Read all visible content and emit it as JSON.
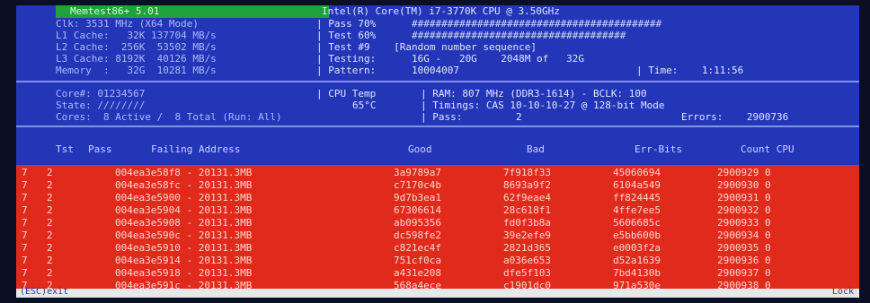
{
  "header": {
    "title": "Memtest86+ 5.01",
    "cpu": "Intel(R) Core(TM) i7-3770K CPU @ 3.50GHz",
    "clk_line": "Clk: 3531 MHz (X64 Mode)",
    "l1_line": "L1 Cache:   32K 137704 MB/s",
    "l2_line": "L2 Cache:  256K  53502 MB/s",
    "l3_line": "L3 Cache: 8192K  40126 MB/s",
    "memory_line": "Memory  :   32G  10281 MB/s",
    "pass_pct": "| Pass 70%",
    "test_pct": "| Test 60%",
    "test_num": "| Test #9    [Random number sequence]",
    "testing": "| Testing:      16G -   20G    2048M of   32G",
    "pattern": "| Pattern:      10004007",
    "time": "| Time:    1:11:56"
  },
  "info": {
    "core_line": "Core#: 01234567",
    "state_line": "State: ////////",
    "cores_line": "Cores:  8 Active /  8 Total (Run: All)",
    "cpu_temp_label": "| CPU Temp",
    "cpu_temp_value": "65°C",
    "ram_line": "| RAM: 807 MHz (DDR3-1614) - BCLK: 100",
    "timings_line": "| Timings: CAS 10-10-10-27 @ 128-bit Mode",
    "pass_line": "| Pass:         2",
    "errors_line": "Errors:    2900736"
  },
  "table": {
    "columns": [
      "Tst",
      "Pass",
      "Failing Address",
      "Good",
      "Bad",
      "Err-Bits",
      "Count CPU"
    ],
    "rows": [
      [
        "7",
        "2",
        "004ea3e58f8 - 20131.3MB",
        "3a9789a7",
        "7f918f33",
        "45060694",
        "2900929 0"
      ],
      [
        "7",
        "2",
        "004ea3e58fc - 20131.3MB",
        "c7170c4b",
        "8693a9f2",
        "6104a549",
        "2900930 0"
      ],
      [
        "7",
        "2",
        "004ea3e5900 - 20131.3MB",
        "9d7b3ea1",
        "62f9eae4",
        "ff824445",
        "2900931 0"
      ],
      [
        "7",
        "2",
        "004ea3e5904 - 20131.3MB",
        "67306614",
        "28c618f1",
        "4ffe7ee5",
        "2900932 0"
      ],
      [
        "7",
        "2",
        "004ea3e5908 - 20131.3MB",
        "ab095356",
        "fd0f3b8a",
        "5606685c",
        "2900933 0"
      ],
      [
        "7",
        "2",
        "004ea3e590c - 20131.3MB",
        "dc598fe2",
        "39e2efe9",
        "e5bb600b",
        "2900934 0"
      ],
      [
        "7",
        "2",
        "004ea3e5910 - 20131.3MB",
        "c821ec4f",
        "2821d365",
        "e0003f2a",
        "2900935 0"
      ],
      [
        "7",
        "2",
        "004ea3e5914 - 20131.3MB",
        "751cf0ca",
        "a036e653",
        "d52a1639",
        "2900936 0"
      ],
      [
        "7",
        "2",
        "004ea3e5918 - 20131.3MB",
        "a431e208",
        "dfe5f103",
        "7bd4130b",
        "2900937 0"
      ],
      [
        "7",
        "2",
        "004ea3e591c - 20131.3MB",
        "568a4ece",
        "c1901dc0",
        "971a530e",
        "2900938 0"
      ]
    ]
  },
  "status_bar": {
    "left": "(ESC)exit",
    "right": "Lock"
  },
  "colors": {
    "screen_bg": "#2436b8",
    "error_bg": "#e02a1c",
    "title_bg": "#1ea23a"
  }
}
